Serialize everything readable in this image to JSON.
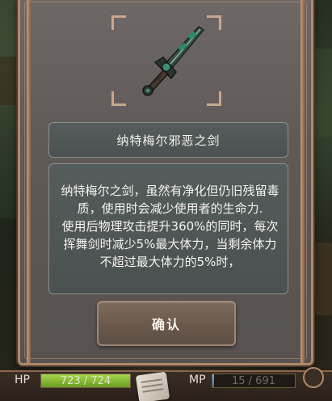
{
  "item": {
    "icon": "dark-sword-icon",
    "name": "纳特梅尔邪恶之剑",
    "description": "纳特梅尔之剑，虽然有净化但仍旧残留毒质，使用时会减少使用者的生命力.\n使用后物理攻击提升360%的同时，每次挥舞剑时减少5%最大体力，当剩余体力不超过最大体力的5%时，"
  },
  "dialog": {
    "confirm_label": "确认"
  },
  "hud": {
    "hp_label": "HP",
    "hp_text": "723 / 724",
    "hp_fraction": 0.9986,
    "mp_label": "MP",
    "mp_text": "15 / 691",
    "mp_fraction": 0.0217,
    "hp_color": "#8fc23a",
    "mp_color": "#3b8fc4"
  },
  "colors": {
    "panel": "#5f5a58",
    "frame": "#b08a6a",
    "text_box": "#4e5555",
    "button": "#6a594c"
  }
}
